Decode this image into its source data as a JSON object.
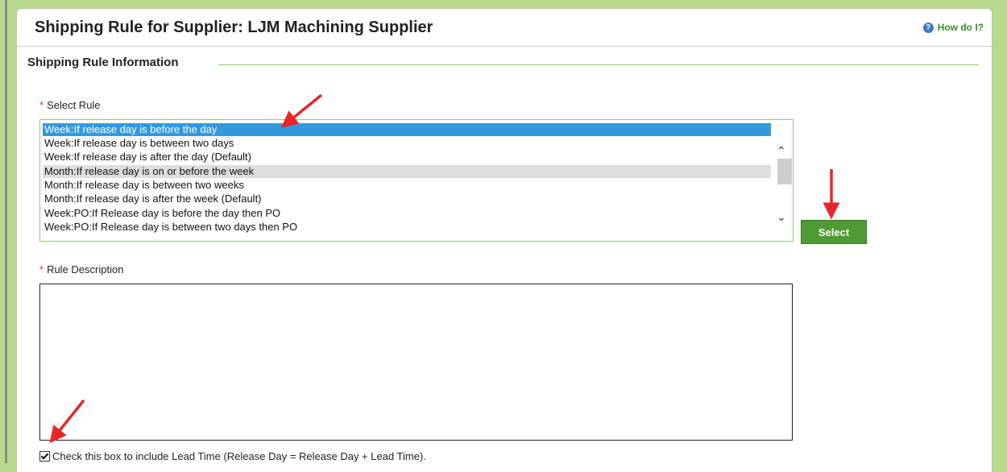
{
  "page": {
    "title": "Shipping Rule for Supplier: LJM Machining Supplier",
    "help_link": "How do I?"
  },
  "section": {
    "title": "Shipping Rule Information"
  },
  "select_rule": {
    "label": "Select Rule",
    "options": [
      "Week:If release day is before the day",
      "Week:If release day is between two days",
      "Week:If release day is after the day (Default)",
      "Month:If release day is on or before the week",
      "Month:If release day is between two weeks",
      "Month:If release day is after the week (Default)",
      "Week:PO:If Release day is before the day then PO",
      "Week:PO:If Release day is between two days then PO"
    ],
    "selected_index": 0,
    "hover_index": 3,
    "button_label": "Select"
  },
  "rule_description": {
    "label": "Rule Description",
    "value": ""
  },
  "lead_time": {
    "label": "Check this box to include Lead Time (Release Day = Release Day + Lead Time).",
    "checked": true
  },
  "colors": {
    "accent_green": "#4f9a34",
    "selection_blue": "#3399dd",
    "annotation_red": "#e8262a",
    "background_green": "#b9d98c"
  },
  "icons": {
    "help": "help-circle-icon",
    "checkbox": "checkmark-icon"
  }
}
